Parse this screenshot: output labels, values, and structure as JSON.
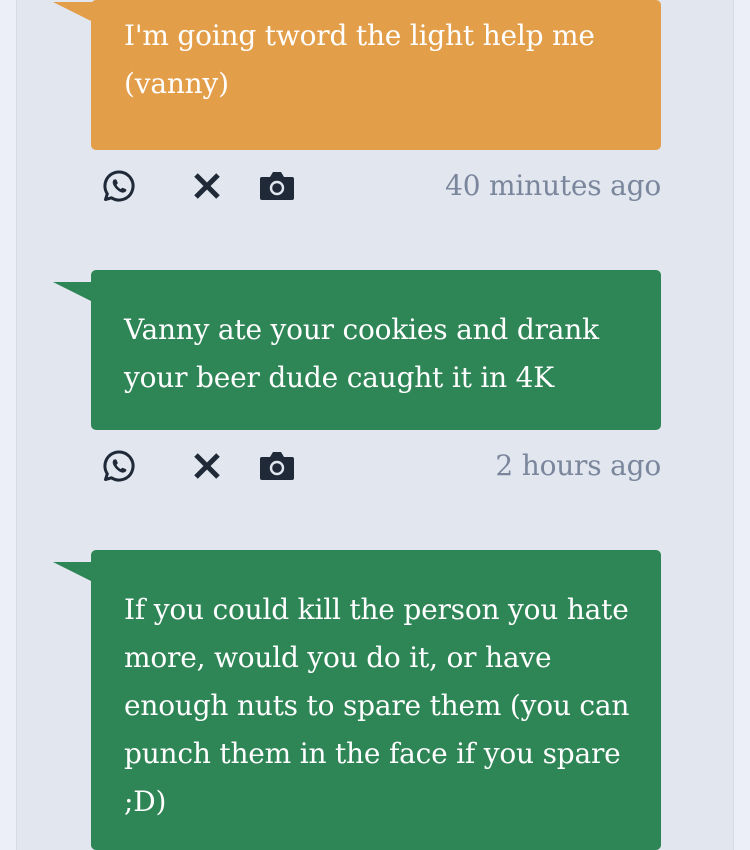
{
  "colors": {
    "page_bg": "#eceff7",
    "column_bg": "#e2e6ef",
    "orange_bubble": "#e39e4a",
    "green_bubble": "#2e8555",
    "timestamp": "#7a869c",
    "icon": "#1f2937"
  },
  "posts": [
    {
      "text": "I'm going tword the light help me (vanny)",
      "color": "orange",
      "timestamp": "40 minutes ago",
      "actions": [
        "whatsapp-icon",
        "close-icon",
        "camera-icon"
      ]
    },
    {
      "text": "Vanny ate your cookies and drank your beer dude caught it in 4K",
      "color": "green",
      "timestamp": "2 hours ago",
      "actions": [
        "whatsapp-icon",
        "close-icon",
        "camera-icon"
      ]
    },
    {
      "text": "If you could kill the person you hate more, would you do it, or have enough nuts to spare them (you can punch them in the face if you spare ;D)",
      "color": "green",
      "timestamp": "",
      "actions": []
    }
  ]
}
